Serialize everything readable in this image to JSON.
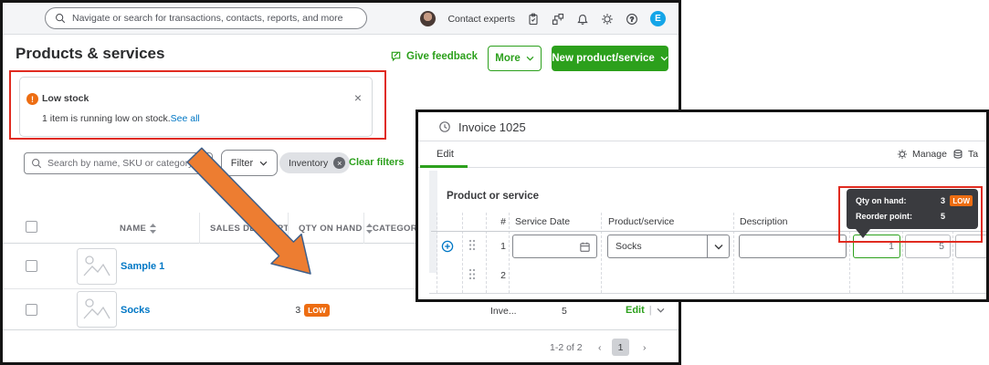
{
  "colors": {
    "brand_green": "#2ca01c",
    "link_blue": "#0077c5",
    "warning_orange": "#ed6d12",
    "annotation_red": "#e02b20",
    "tooltip_bg": "#3a3b3f",
    "arrow_fill": "#ED7D31"
  },
  "main": {
    "topbar": {
      "search_placeholder": "Navigate or search for transactions, contacts, reports, and more",
      "contact_experts": "Contact experts",
      "icons": [
        "clipboard-icon",
        "org-chart-icon",
        "bell-icon",
        "gear-icon",
        "help-icon"
      ],
      "avatar_initial": "E"
    },
    "header": {
      "title": "Products & services",
      "give_feedback": "Give feedback",
      "more": "More",
      "new_product": "New product/service"
    },
    "alert": {
      "icon": "!",
      "title": "Low stock",
      "message": "1 item is running low on stock.",
      "see_all": "See all",
      "close": "×"
    },
    "filters": {
      "search_placeholder": "Search by name, SKU or category",
      "filter": "Filter",
      "chip": "Inventory",
      "chip_remove": "×",
      "clear": "Clear filters"
    },
    "table": {
      "headers": [
        "NAME",
        "SALES DESCRIPTION",
        "QTY ON HAND",
        "CATEGORY"
      ],
      "rows": [
        {
          "name": "Sample 1"
        },
        {
          "name": "Socks",
          "qty": "3",
          "low": "LOW",
          "type": "Inve...",
          "reorder": "5",
          "action": "Edit",
          "action_sep": "|"
        }
      ]
    },
    "pagination": {
      "range": "1-2 of 2",
      "prev": "‹",
      "page": "1",
      "next": "›"
    }
  },
  "invoice": {
    "title": "Invoice 1025",
    "tab": "Edit",
    "manage": "Manage",
    "tour": "Ta",
    "section": "Product or service",
    "grid": {
      "headers": [
        "#",
        "Service Date",
        "Product/service",
        "Description"
      ],
      "row1": {
        "num": "1",
        "product": "Socks",
        "qty": "1",
        "rate": "5"
      },
      "row2": {
        "num": "2"
      }
    },
    "tooltip": {
      "qty_label": "Qty on hand:",
      "qty_value": "3",
      "low": "LOW",
      "reorder_label": "Reorder point:",
      "reorder_value": "5"
    }
  }
}
